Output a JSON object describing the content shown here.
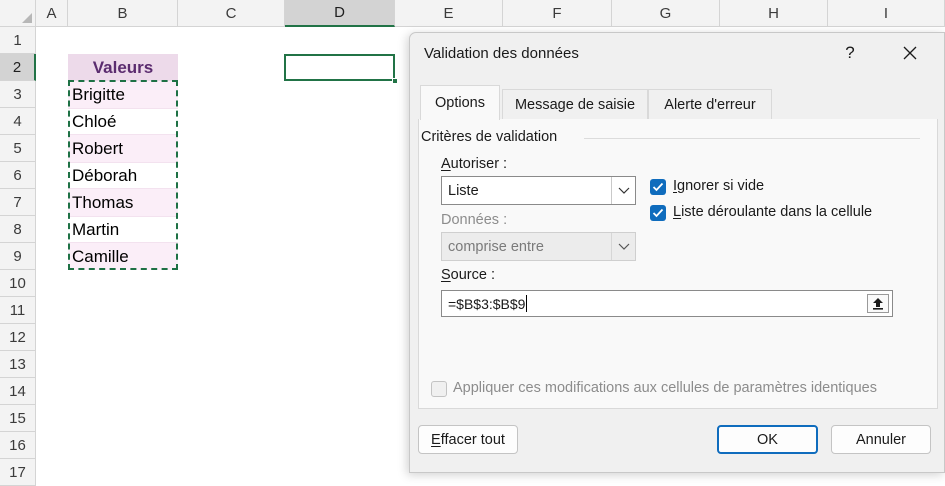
{
  "sheet": {
    "columns": [
      "A",
      "B",
      "C",
      "D",
      "E",
      "F",
      "G",
      "H",
      "I"
    ],
    "selected_column": "D",
    "rows": [
      "1",
      "2",
      "3",
      "4",
      "5",
      "6",
      "7",
      "8",
      "9",
      "10",
      "11",
      "12",
      "13",
      "14",
      "15",
      "16",
      "17"
    ],
    "selected_row": "2",
    "header_cell": "Valeurs",
    "values": [
      "Brigitte",
      "Chloé",
      "Robert",
      "Déborah",
      "Thomas",
      "Martin",
      "Camille"
    ]
  },
  "dialog": {
    "title": "Validation des données",
    "help": "?",
    "tabs": [
      "Options",
      "Message de saisie",
      "Alerte d'erreur"
    ],
    "active_tab": "Options",
    "group_title": "Critères de validation",
    "allow_label_accel": "A",
    "allow_label_rest": "utoriser :",
    "allow_value": "Liste",
    "data_label": "Données :",
    "data_value": "comprise entre",
    "ignore_blank_accel": "I",
    "ignore_blank_rest": "gnorer si vide",
    "ignore_blank_checked": true,
    "in_cell_dropdown_accel": "L",
    "in_cell_dropdown_rest": "iste déroulante dans la cellule",
    "in_cell_dropdown_checked": true,
    "source_label_accel": "S",
    "source_label_rest": "ource :",
    "source_value": "=$B$3:$B$9",
    "apply_all_label": "Appliquer ces modifications aux cellules de paramètres identiques",
    "apply_all_checked": false,
    "clear_all_accel": "E",
    "clear_all_rest": "ffacer tout",
    "ok_label": "OK",
    "cancel_label": "Annuler"
  },
  "colors": {
    "accent": "#0f6cbd",
    "excel_green": "#217346",
    "header_fill": "#eddaea",
    "header_text": "#5b2c6f"
  }
}
